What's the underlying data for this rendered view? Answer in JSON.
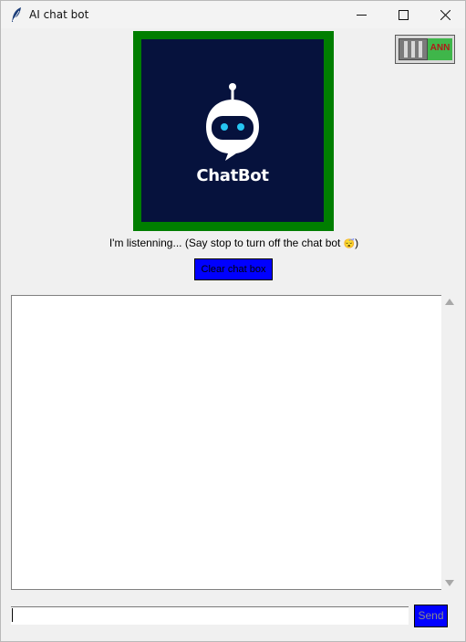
{
  "window": {
    "title": "AI chat bot"
  },
  "logo": {
    "text": "ChatBot"
  },
  "toggle": {
    "label": "ANN"
  },
  "status": {
    "text": "I'm listenning... (Say stop to turn off the chat bot ",
    "emoji": "😴",
    "suffix": ")"
  },
  "buttons": {
    "clear_label": "Clear chat box",
    "send_label": "Send"
  },
  "input": {
    "value": ""
  },
  "colors": {
    "logo_border": "#007e00",
    "logo_bg": "#06123d",
    "button_bg": "#0000ff",
    "toggle_on": "#3fb64a",
    "toggle_text": "#b01919"
  }
}
